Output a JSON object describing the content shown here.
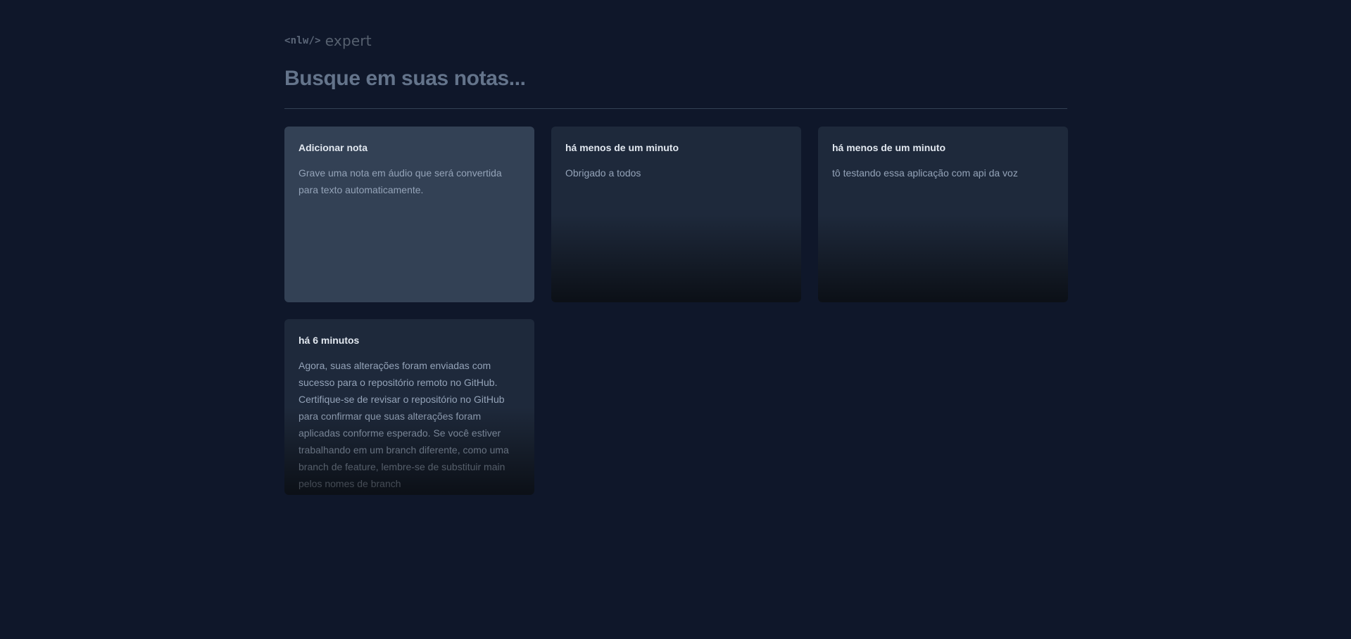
{
  "logo": {
    "code_text": "<nlw/>",
    "brand_text": "expert"
  },
  "search": {
    "placeholder": "Busque em suas notas..."
  },
  "add_card": {
    "title": "Adicionar nota",
    "description": "Grave uma nota em áudio que será convertida para texto automaticamente."
  },
  "notes": [
    {
      "date": "há menos de um minuto",
      "content": "Obrigado a todos"
    },
    {
      "date": "há menos de um minuto",
      "content": "tô testando essa aplicação com api da voz"
    },
    {
      "date": "há 6 minutos",
      "content": "Agora, suas alterações foram enviadas com sucesso para o repositório remoto no GitHub. Certifique-se de revisar o repositório no GitHub para confirmar que suas alterações foram aplicadas conforme esperado. Se você estiver trabalhando em um branch diferente, como uma branch de feature, lembre-se de substituir main pelos nomes de branch"
    }
  ],
  "colors": {
    "background": "#0f172a",
    "card": "#1e293b",
    "add_card": "#334155",
    "title_text": "#e2e8f0",
    "body_text": "#94a3b8",
    "placeholder_text": "#64748b"
  }
}
